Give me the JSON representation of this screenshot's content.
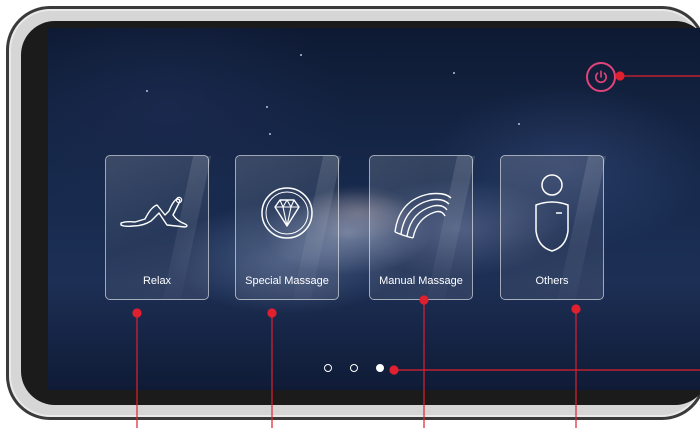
{
  "screen": {
    "tiles": [
      {
        "label": "Relax",
        "icon": "reclining-figure-icon"
      },
      {
        "label": "Special Massage",
        "icon": "diamond-icon"
      },
      {
        "label": "Manual Massage",
        "icon": "hand-stroke-icon"
      },
      {
        "label": "Others",
        "icon": "person-icon"
      }
    ],
    "power": {
      "icon": "power-icon"
    },
    "pagination": {
      "pages": 3,
      "current": 3
    }
  },
  "colors": {
    "callout": "#e0202e",
    "power_accent": "#e0447a",
    "tile_text": "#ffffff"
  }
}
